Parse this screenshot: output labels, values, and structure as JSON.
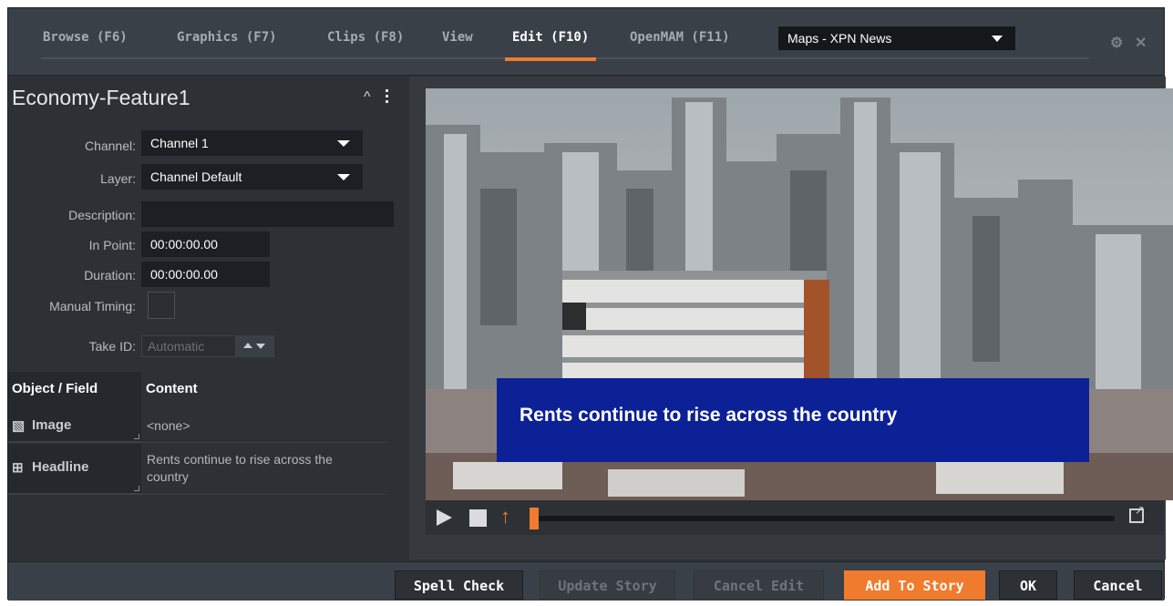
{
  "tabs": [
    {
      "label": "Browse (F6)"
    },
    {
      "label": "Graphics (F7)"
    },
    {
      "label": "Clips (F8)"
    },
    {
      "label": "View"
    },
    {
      "label": "Edit (F10)",
      "active": true
    },
    {
      "label": "OpenMAM (F11)"
    }
  ],
  "map_select": {
    "value": "Maps - XPN News"
  },
  "item": {
    "title": "Economy-Feature1"
  },
  "fields": {
    "channel": {
      "label": "Channel:",
      "value": "Channel 1"
    },
    "layer": {
      "label": "Layer:",
      "value": "Channel Default"
    },
    "description": {
      "label": "Description:",
      "value": ""
    },
    "in_point": {
      "label": "In Point:",
      "value": "00:00:00.00"
    },
    "duration": {
      "label": "Duration:",
      "value": "00:00:00.00"
    },
    "manual_timing": {
      "label": "Manual Timing:",
      "checked": false
    },
    "take_id": {
      "label": "Take ID:",
      "placeholder": "Automatic"
    }
  },
  "table": {
    "headers": [
      "Object / Field",
      "Content"
    ],
    "rows": [
      {
        "icon": "image-icon",
        "object": "Image",
        "content": "<none>"
      },
      {
        "icon": "expand-icon",
        "object": "Headline",
        "content": "Rents continue to rise across the country"
      }
    ]
  },
  "preview": {
    "headline_text": "Rents continue to rise across the country",
    "playhead": 0
  },
  "buttons": {
    "spell_check": "Spell Check",
    "update_story": "Update Story",
    "cancel_edit": "Cancel Edit",
    "add_to_story": "Add To Story",
    "ok": "OK",
    "cancel": "Cancel"
  },
  "colors": {
    "accent": "#f07b2d",
    "headline_bg": "#0d2196",
    "panel": "#2d3135"
  }
}
